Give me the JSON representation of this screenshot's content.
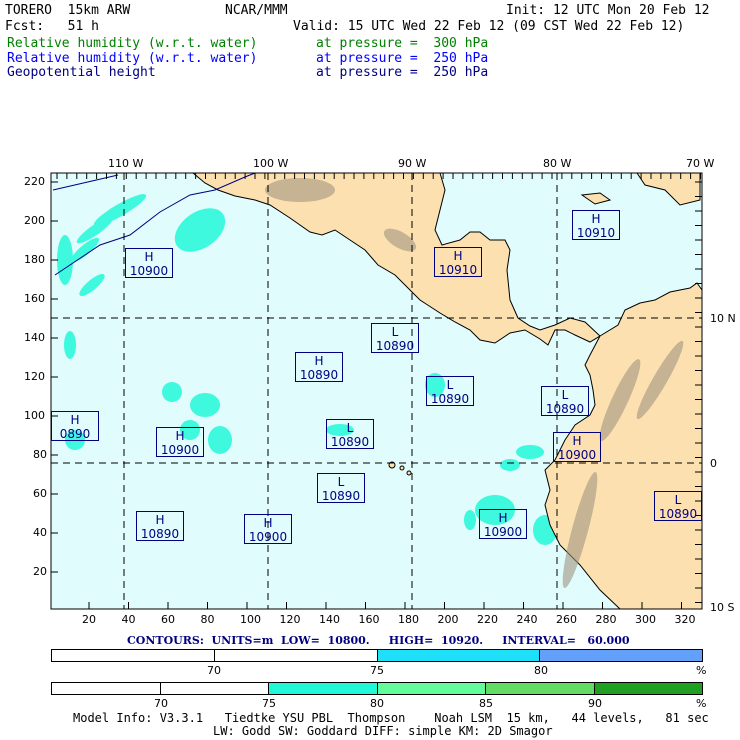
{
  "header": {
    "model": "TORERO  15km ARW",
    "org": "NCAR/MMM",
    "init": "Init: 12 UTC Mon 20 Feb 12",
    "fcst": "Fcst:   51 h",
    "valid": "Valid: 15 UTC Wed 22 Feb 12 (09 CST Wed 22 Feb 12)",
    "fields": [
      {
        "name": "Relative humidity (w.r.t. water)",
        "level": "at pressure =  300 hPa",
        "color": "#008000"
      },
      {
        "name": "Relative humidity (w.r.t. water)",
        "level": "at pressure =  250 hPa",
        "color": "#0000ff"
      },
      {
        "name": "Geopotential height",
        "level": "at pressure =  250 hPa",
        "color": "#000080"
      }
    ]
  },
  "map": {
    "top_lon_labels": [
      "110 W",
      "100 W",
      "90 W",
      "80 W",
      "70 W"
    ],
    "right_lat_labels": [
      "10 N",
      "0",
      "10 S"
    ],
    "y_ticks": [
      "220",
      "200",
      "180",
      "160",
      "140",
      "120",
      "100",
      "80",
      "60",
      "40",
      "20"
    ],
    "x_ticks": [
      "20",
      "40",
      "60",
      "80",
      "100",
      "120",
      "140",
      "160",
      "180",
      "200",
      "220",
      "240",
      "260",
      "280",
      "300",
      "320"
    ],
    "centers": [
      {
        "type": "H",
        "value": "10900"
      },
      {
        "type": "H",
        "value": "10910"
      },
      {
        "type": "H",
        "value": "10910"
      },
      {
        "type": "L",
        "value": "10890"
      },
      {
        "type": "H",
        "value": "10890"
      },
      {
        "type": "L",
        "value": "10890"
      },
      {
        "type": "L",
        "value": "10890"
      },
      {
        "type": "H",
        "value": "0890"
      },
      {
        "type": "H",
        "value": "10900"
      },
      {
        "type": "L",
        "value": "10890"
      },
      {
        "type": "H",
        "value": "10900"
      },
      {
        "type": "L",
        "value": "10890"
      },
      {
        "type": "L",
        "value": "10890"
      },
      {
        "type": "H",
        "value": "10890"
      },
      {
        "type": "H",
        "value": "10900"
      },
      {
        "type": "H",
        "value": "10900"
      }
    ],
    "colors": {
      "ocean": "#e0fcfc",
      "land": "#fce0b0",
      "rh": "#20f8d8"
    }
  },
  "contours": "CONTOURS:  UNITS=m  LOW=  10800.     HIGH=  10920.     INTERVAL=   60.000",
  "colorbar1": {
    "labels": [
      "70",
      "75",
      "80",
      "%"
    ],
    "colors": [
      "#ffffff",
      "#ffffff",
      "#1ee0f8",
      "#62a0fc"
    ]
  },
  "colorbar2": {
    "labels": [
      "70",
      "75",
      "80",
      "85",
      "90",
      "%"
    ],
    "colors": [
      "#ffffff",
      "#ffffff",
      "#20f8d8",
      "#62fc9c",
      "#62dc62",
      "#20a020"
    ]
  },
  "footer": {
    "line1": "Model Info: V3.3.1   Tiedtke YSU PBL  Thompson    Noah LSM  15 km,   44 levels,   81 sec",
    "line2": "LW: Godd SW: Goddard DIFF: simple KM: 2D Smagor"
  }
}
